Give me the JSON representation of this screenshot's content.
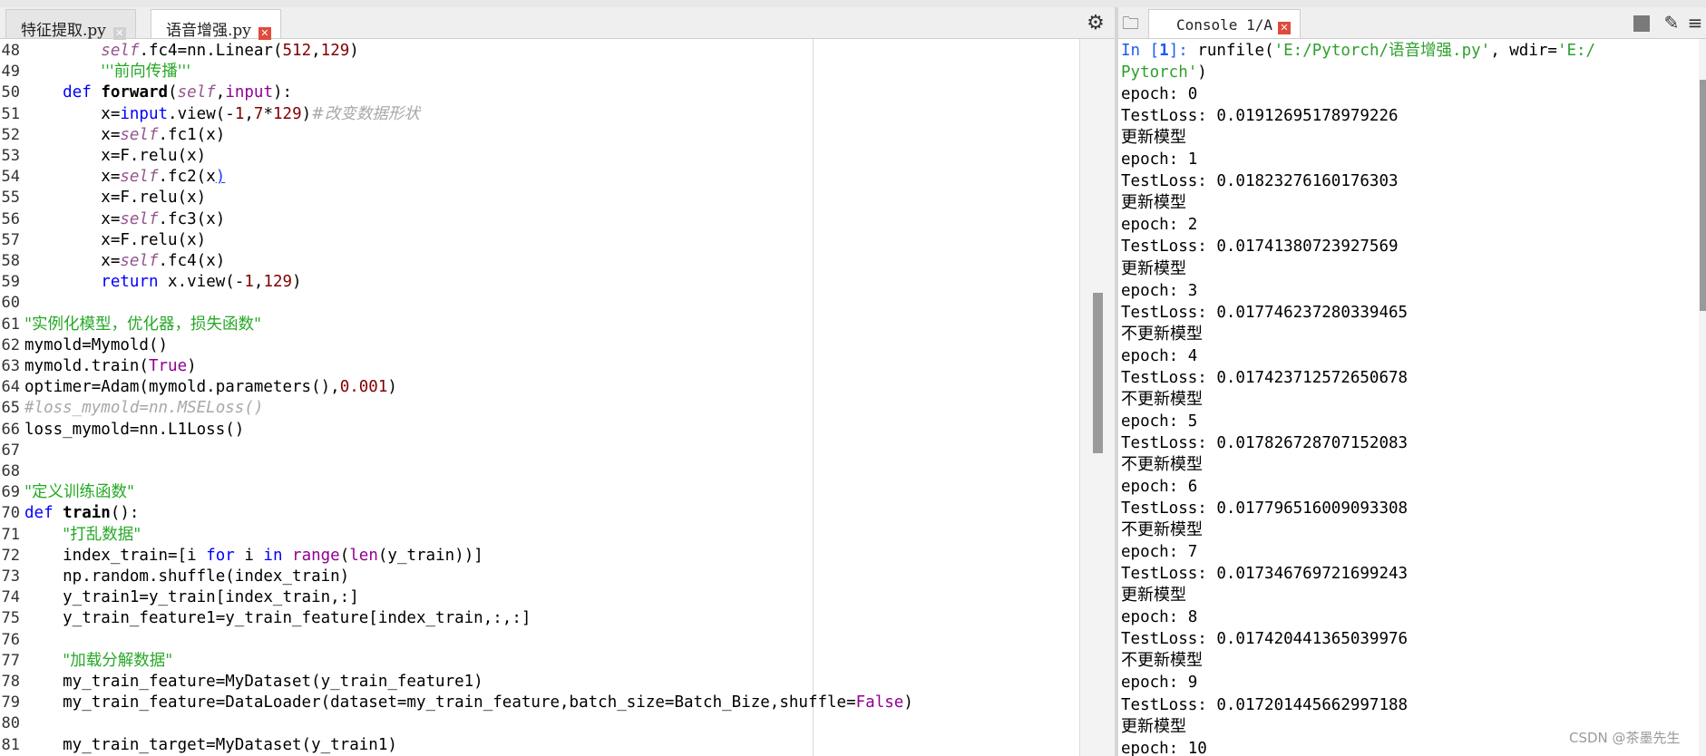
{
  "editor": {
    "tabs": [
      {
        "label": "特征提取.py",
        "active": false
      },
      {
        "label": "语音增强.py",
        "active": true
      }
    ],
    "settings_icon": "gear-icon",
    "close_icon": "close-icon",
    "lines": [
      {
        "n": "48",
        "html": "        <span class=\"self\">self</span>.fc4=nn.Linear(<span class=\"num\">512</span>,<span class=\"num\">129</span>)"
      },
      {
        "n": "49",
        "html": "        <span class=\"strc\">'''前向传播'''</span>"
      },
      {
        "n": "50",
        "html": "    <span class=\"kw\">def</span> <span class=\"fn\">forward</span>(<span class=\"self\">self</span>,<span class=\"bi\">input</span>):"
      },
      {
        "n": "51",
        "html": "        x=<span class=\"bi\" style=\"color:#0000ff\">input</span>.view(-<span class=\"num\">1</span>,<span class=\"num\">7</span>*<span class=\"num\">129</span>)<span class=\"cmc\">#改变数据形状</span>"
      },
      {
        "n": "52",
        "html": "        x=<span class=\"self\">self</span>.fc1(x)"
      },
      {
        "n": "53",
        "html": "        x=F.relu(x)"
      },
      {
        "n": "54",
        "html": "        x=<span class=\"self\">self</span>.fc2(x<span class=\"uline\">)</span>"
      },
      {
        "n": "55",
        "html": "        x=F.relu(x)"
      },
      {
        "n": "56",
        "html": "        x=<span class=\"self\">self</span>.fc3(x)"
      },
      {
        "n": "57",
        "html": "        x=F.relu(x)"
      },
      {
        "n": "58",
        "html": "        x=<span class=\"self\">self</span>.fc4(x)"
      },
      {
        "n": "59",
        "html": "        <span class=\"kw\">return</span> x.view(-<span class=\"num\">1</span>,<span class=\"num\">129</span>)"
      },
      {
        "n": "60",
        "html": ""
      },
      {
        "n": "61",
        "html": "<span class=\"strc\">\"实例化模型，优化器，损失函数\"</span>"
      },
      {
        "n": "62",
        "html": "mymold=Mymold()"
      },
      {
        "n": "63",
        "html": "mymold.train(<span class=\"bi\">True</span>)"
      },
      {
        "n": "64",
        "html": "optimer=Adam(mymold.parameters(),<span class=\"num\">0.001</span>)"
      },
      {
        "n": "65",
        "html": "<span class=\"cm\">#loss_mymold=nn.MSELoss()</span>"
      },
      {
        "n": "66",
        "html": "loss_mymold=nn.L1Loss()"
      },
      {
        "n": "67",
        "html": ""
      },
      {
        "n": "68",
        "html": ""
      },
      {
        "n": "69",
        "html": "<span class=\"strc\">\"定义训练函数\"</span>"
      },
      {
        "n": "70",
        "html": "<span class=\"kw\">def</span> <span class=\"fn\">train</span>():"
      },
      {
        "n": "71",
        "html": "    <span class=\"strc\">\"打乱数据\"</span>"
      },
      {
        "n": "72",
        "html": "    index_train=[i <span class=\"kw\">for</span> i <span class=\"kw\">in</span> <span class=\"bi\">range</span>(<span class=\"bi\">len</span>(y_train))]"
      },
      {
        "n": "73",
        "html": "    np.random.shuffle(index_train)"
      },
      {
        "n": "74",
        "html": "    y_train1=y_train[index_train,:]"
      },
      {
        "n": "75",
        "html": "    y_train_feature1=y_train_feature[index_train,:,:]"
      },
      {
        "n": "76",
        "html": ""
      },
      {
        "n": "77",
        "html": "    <span class=\"strc\">\"加载分解数据\"</span>"
      },
      {
        "n": "78",
        "html": "    my_train_feature=MyDataset(y_train_feature1)"
      },
      {
        "n": "79",
        "html": "    my_train_feature=DataLoader(dataset=my_train_feature,batch_size=Batch_Bize,shuffle=<span class=\"bi\">False</span>)"
      },
      {
        "n": "80",
        "html": ""
      },
      {
        "n": "81",
        "html": "    my_train_target=MyDataset(y_train1)"
      }
    ]
  },
  "console": {
    "tab_label": "Console 1/A",
    "folder_icon": "folder-icon",
    "stop_icon": "stop-icon",
    "clear_icon": "eraser-icon",
    "menu_icon": "more-icon",
    "lines": [
      {
        "html": "<span class=\"prompt\">In [</span><span class=\"prompt\" style=\"font-weight:bold\">1</span><span class=\"prompt\">]:</span> runfile(<span class=\"cstr\">'E:/Pytorch/语音增强.py'</span>, wdir=<span class=\"cstr\">'E:/</span>",
        "cn": false
      },
      {
        "html": "<span class=\"cstr\">Pytorch'</span>)",
        "cn": false
      },
      {
        "html": "epoch: 0",
        "cn": false
      },
      {
        "html": "TestLoss: 0.01912695178979226",
        "cn": false
      },
      {
        "html": "更新模型",
        "cn": true
      },
      {
        "html": "epoch: 1",
        "cn": false
      },
      {
        "html": "TestLoss: 0.01823276160176303",
        "cn": false
      },
      {
        "html": "更新模型",
        "cn": true
      },
      {
        "html": "epoch: 2",
        "cn": false
      },
      {
        "html": "TestLoss: 0.01741380723927569",
        "cn": false
      },
      {
        "html": "更新模型",
        "cn": true
      },
      {
        "html": "epoch: 3",
        "cn": false
      },
      {
        "html": "TestLoss: 0.017746237280339465",
        "cn": false
      },
      {
        "html": "不更新模型",
        "cn": true
      },
      {
        "html": "epoch: 4",
        "cn": false
      },
      {
        "html": "TestLoss: 0.017423712572650678",
        "cn": false
      },
      {
        "html": "不更新模型",
        "cn": true
      },
      {
        "html": "epoch: 5",
        "cn": false
      },
      {
        "html": "TestLoss: 0.017826728707152083",
        "cn": false
      },
      {
        "html": "不更新模型",
        "cn": true
      },
      {
        "html": "epoch: 6",
        "cn": false
      },
      {
        "html": "TestLoss: 0.017796516009093308",
        "cn": false
      },
      {
        "html": "不更新模型",
        "cn": true
      },
      {
        "html": "epoch: 7",
        "cn": false
      },
      {
        "html": "TestLoss: 0.017346769721699243",
        "cn": false
      },
      {
        "html": "更新模型",
        "cn": true
      },
      {
        "html": "epoch: 8",
        "cn": false
      },
      {
        "html": "TestLoss: 0.017420441365039976",
        "cn": false
      },
      {
        "html": "不更新模型",
        "cn": true
      },
      {
        "html": "epoch: 9",
        "cn": false
      },
      {
        "html": "TestLoss: 0.017201445662997188",
        "cn": false
      },
      {
        "html": "更新模型",
        "cn": true
      },
      {
        "html": "epoch: 10",
        "cn": false
      }
    ]
  },
  "watermark": "CSDN @茶墨先生"
}
